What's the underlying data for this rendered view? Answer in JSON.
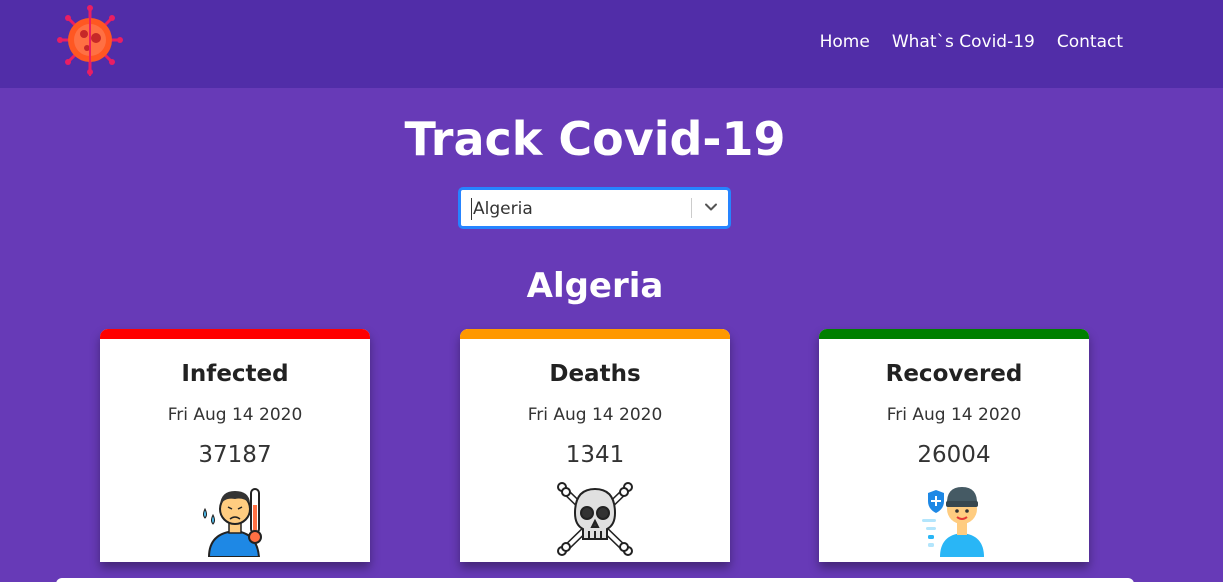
{
  "nav": {
    "logo_icon": "virus-icon",
    "links": [
      "Home",
      "What`s Covid-19",
      "Contact"
    ]
  },
  "title": "Track Covid-19",
  "country_select": {
    "value": "Algeria",
    "icon": "chevron-down-icon"
  },
  "country_heading": "Algeria",
  "cards": [
    {
      "title": "Infected",
      "date": "Fri Aug 14 2020",
      "value": "37187",
      "color": "#ff0000",
      "icon": "sick-person-icon"
    },
    {
      "title": "Deaths",
      "date": "Fri Aug 14 2020",
      "value": "1341",
      "color": "#ff9800",
      "icon": "skull-crossbones-icon"
    },
    {
      "title": "Recovered",
      "date": "Fri Aug 14 2020",
      "value": "26004",
      "color": "#008000",
      "icon": "recovered-person-icon"
    }
  ],
  "colors": {
    "navbar": "#512da8",
    "background": "#673ab7"
  }
}
